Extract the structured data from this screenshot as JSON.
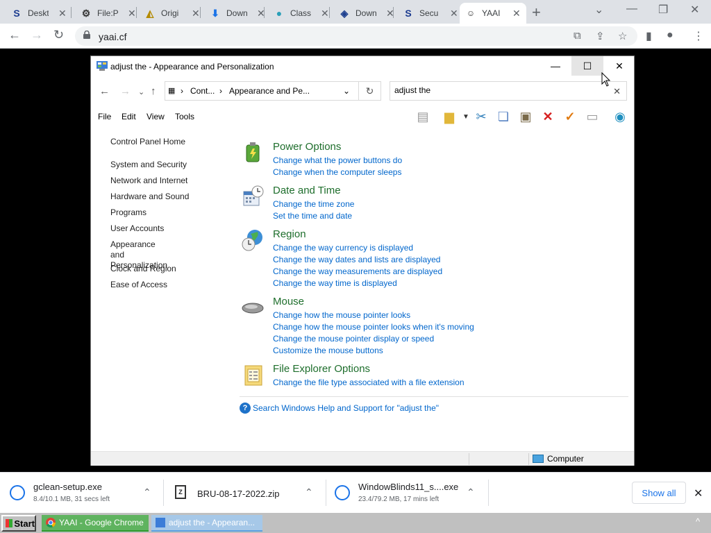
{
  "browser": {
    "tabs": [
      {
        "label": "Deskt",
        "icon": "s-logo-icon"
      },
      {
        "label": "File:P",
        "icon": "wiki-icon"
      },
      {
        "label": "Origi",
        "icon": "drive-icon"
      },
      {
        "label": "Down",
        "icon": "download-icon"
      },
      {
        "label": "Class",
        "icon": "globe-icon"
      },
      {
        "label": "Down",
        "icon": "book-icon"
      },
      {
        "label": "Secu",
        "icon": "s-logo-icon"
      },
      {
        "label": "YAAI",
        "icon": "smiley-icon",
        "active": true
      }
    ],
    "new_tab": "+",
    "url": "yaai.cf",
    "accent": "#1a73e8"
  },
  "explorer": {
    "title": "adjust the - Appearance and Personalization",
    "breadcrumb": [
      "Cont...",
      "Appearance and Pe..."
    ],
    "search_value": "adjust the",
    "menu": [
      "File",
      "Edit",
      "View",
      "Tools"
    ],
    "sidebar": {
      "home": "Control Panel Home",
      "items": [
        "System and Security",
        "Network and Internet",
        "Hardware and Sound",
        "Programs",
        "User Accounts",
        "Appearance and\nPersonalization",
        "Clock and Region",
        "Ease of Access"
      ]
    },
    "categories": [
      {
        "title": "Power Options",
        "links": [
          "Change what the power buttons do",
          "Change when the computer sleeps"
        ],
        "icon": "battery-icon"
      },
      {
        "title": "Date and Time",
        "links": [
          "Change the time zone",
          "Set the time and date"
        ],
        "icon": "calendar-clock-icon"
      },
      {
        "title": "Region",
        "links": [
          "Change the way currency is displayed",
          "Change the way dates and lists are displayed",
          "Change the way measurements are displayed",
          "Change the way time is displayed"
        ],
        "icon": "globe-clock-icon"
      },
      {
        "title": "Mouse",
        "links": [
          "Change how the mouse pointer looks",
          "Change how the mouse pointer looks when it's moving",
          "Change the mouse pointer display or speed",
          "Customize the mouse buttons"
        ],
        "icon": "mouse-icon"
      },
      {
        "title": "File Explorer Options",
        "links": [
          "Change the file type associated with a file extension"
        ],
        "icon": "folder-options-icon"
      }
    ],
    "help_text": "Search Windows Help and Support for \"adjust the\"",
    "status": "Computer",
    "title_color": "#1e6e2c",
    "link_color": "#0066cc"
  },
  "downloads": [
    {
      "name": "gclean-setup.exe",
      "sub": "8.4/10.1 MB, 31 secs left"
    },
    {
      "name": "BRU-08-17-2022.zip",
      "sub": ""
    },
    {
      "name": "WindowBlinds11_s....exe",
      "sub": "23.4/79.2 MB, 17 mins left"
    }
  ],
  "show_all": "Show all",
  "taskbar": {
    "start": "Start",
    "tasks": [
      "YAAI - Google Chrome",
      "adjust the - Appearan..."
    ]
  }
}
